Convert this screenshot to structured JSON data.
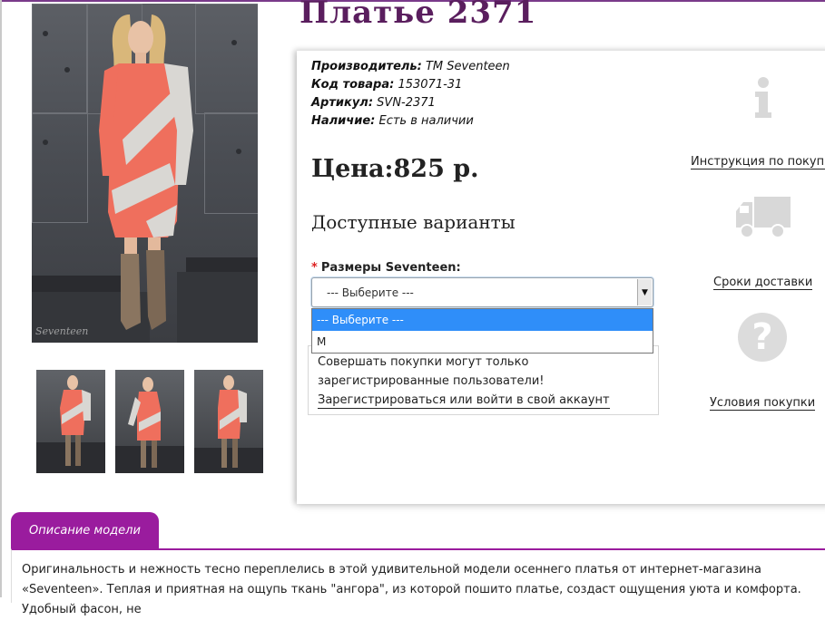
{
  "product": {
    "title": "Платье 2371",
    "specs": [
      {
        "label": "Производитель:",
        "value": "ТМ Seventeen"
      },
      {
        "label": "Код товара:",
        "value": "153071-31"
      },
      {
        "label": "Артикул:",
        "value": "SVN-2371"
      },
      {
        "label": "Наличие:",
        "value": "Есть в наличии"
      }
    ],
    "price": "Цена:825 р.",
    "photo_watermark": "Seventeen"
  },
  "variants": {
    "title": "Доступные варианты",
    "required_mark": "*",
    "size_label": "Размеры Seventeen:",
    "select_value": "--- Выберите ---",
    "options": [
      "--- Выберите ---",
      "M"
    ],
    "notice": "Совершать покупки могут только зарегистрированные пользователи!",
    "login_link": "Зарегистрироваться или войти в свой аккаунт"
  },
  "side": {
    "instruction_link": "Инструкция по покупке",
    "delivery_link": "Сроки доставки",
    "terms_link": "Условия покупки",
    "question_glyph": "?"
  },
  "description": {
    "tab_label": "Описание модели",
    "text": "Оригинальность и нежность тесно переплелись в этой удивительной модели осеннего платья от интернет-магазина «Seventeen». Теплая и приятная на ощупь ткань \"ангора\", из которой пошито платье, создаст ощущения уюта и комфорта. Удобный фасон, не"
  },
  "colors": {
    "title": "#5a1e5e",
    "accent": "#9a1c9e",
    "dropdown_selected": "#2f8ef9",
    "dress_coral": "#ef6f5d",
    "dress_grey": "#d9d7d3"
  }
}
